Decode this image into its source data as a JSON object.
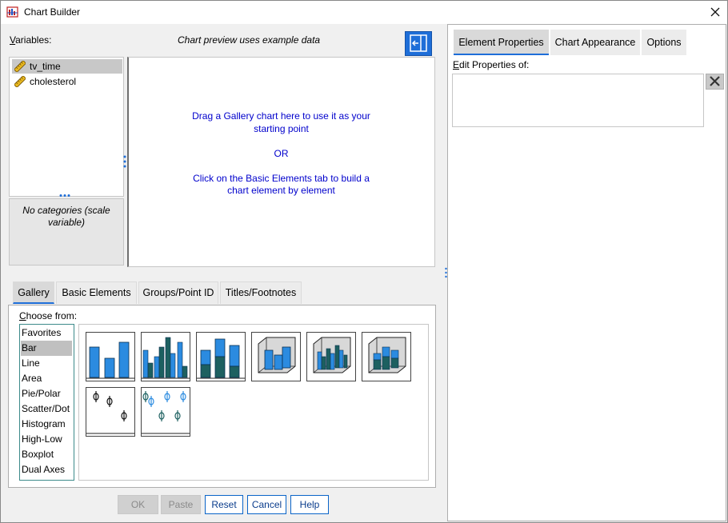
{
  "window": {
    "title": "Chart Builder",
    "close_icon": "close-icon",
    "app_icon": "chart-builder-icon"
  },
  "left": {
    "variables_label_underlined": "V",
    "variables_label_rest": "ariables:",
    "preview_label": "Chart preview uses example data",
    "variables": [
      {
        "name": "tv_time",
        "icon": "scale-ruler-icon",
        "selected": true
      },
      {
        "name": "cholesterol",
        "icon": "scale-ruler-icon",
        "selected": false
      }
    ],
    "no_categories": "No categories (scale variable)",
    "canvas_message": [
      "Drag a Gallery chart here to use it as your",
      "starting point",
      "",
      "OR",
      "",
      "Click on the Basic Elements tab to build a",
      "chart element by element"
    ],
    "accent_color": "#0000cc"
  },
  "tabs": [
    {
      "label": "Gallery",
      "active": true
    },
    {
      "label": "Basic Elements",
      "active": false
    },
    {
      "label": "Groups/Point ID",
      "active": false
    },
    {
      "label": "Titles/Footnotes",
      "active": false
    }
  ],
  "gallery": {
    "choose_underlined": "C",
    "choose_rest": "hoose from:",
    "chart_types": [
      "Favorites",
      "Bar",
      "Line",
      "Area",
      "Pie/Polar",
      "Scatter/Dot",
      "Histogram",
      "High-Low",
      "Boxplot",
      "Dual Axes"
    ],
    "selected_type": "Bar",
    "thumbnails": [
      "simple-bar-thumbnail",
      "clustered-bar-thumbnail",
      "stacked-bar-thumbnail",
      "simple-3d-bar-thumbnail",
      "clustered-3d-bar-thumbnail",
      "stacked-3d-bar-thumbnail",
      "simple-error-bar-thumbnail",
      "clustered-error-bar-thumbnail"
    ]
  },
  "buttons": [
    {
      "label": "OK",
      "enabled": false
    },
    {
      "label": "Paste",
      "enabled": false
    },
    {
      "label": "Reset",
      "enabled": true
    },
    {
      "label": "Cancel",
      "enabled": true
    },
    {
      "label": "Help",
      "enabled": true
    }
  ],
  "right": {
    "tabs": [
      {
        "label": "Element Properties",
        "active": true
      },
      {
        "label": "Chart Appearance",
        "active": false
      },
      {
        "label": "Options",
        "active": false
      }
    ],
    "edit_underlined": "E",
    "edit_rest": "dit Properties of:",
    "delete_icon": "delete-x-icon"
  }
}
